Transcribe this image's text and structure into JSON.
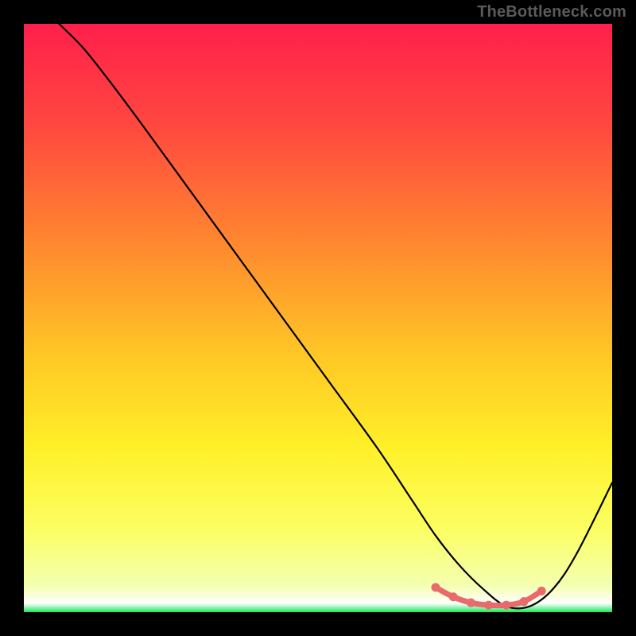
{
  "watermark": "TheBottleneck.com",
  "chart_data": {
    "type": "line",
    "title": "",
    "xlabel": "",
    "ylabel": "",
    "xlim": [
      0,
      100
    ],
    "ylim": [
      0,
      100
    ],
    "grid": false,
    "legend": false,
    "gradient_stops": [
      {
        "offset": 0.0,
        "color": "#ff1f4b"
      },
      {
        "offset": 0.18,
        "color": "#ff4a3f"
      },
      {
        "offset": 0.38,
        "color": "#ff8a2f"
      },
      {
        "offset": 0.56,
        "color": "#ffc626"
      },
      {
        "offset": 0.72,
        "color": "#fff028"
      },
      {
        "offset": 0.86,
        "color": "#fcff63"
      },
      {
        "offset": 0.955,
        "color": "#f4ffb0"
      },
      {
        "offset": 0.985,
        "color": "#ffffff"
      },
      {
        "offset": 1.0,
        "color": "#18e858"
      }
    ],
    "series": [
      {
        "name": "bottleneck-curve",
        "color": "#000000",
        "x": [
          6,
          10,
          14,
          20,
          28,
          36,
          44,
          52,
          60,
          66,
          70,
          74,
          78,
          82,
          86,
          90,
          94,
          100
        ],
        "y": [
          100,
          96,
          91,
          83,
          72,
          61,
          50,
          39,
          28,
          19,
          13,
          8,
          4,
          1,
          1,
          4,
          10,
          22
        ]
      }
    ],
    "highlight": {
      "name": "optimal-range",
      "color": "#e86a6a",
      "x": [
        70,
        73,
        76,
        79,
        82,
        85,
        88
      ],
      "y": [
        4.2,
        2.6,
        1.6,
        1.2,
        1.2,
        1.8,
        3.6
      ]
    }
  }
}
